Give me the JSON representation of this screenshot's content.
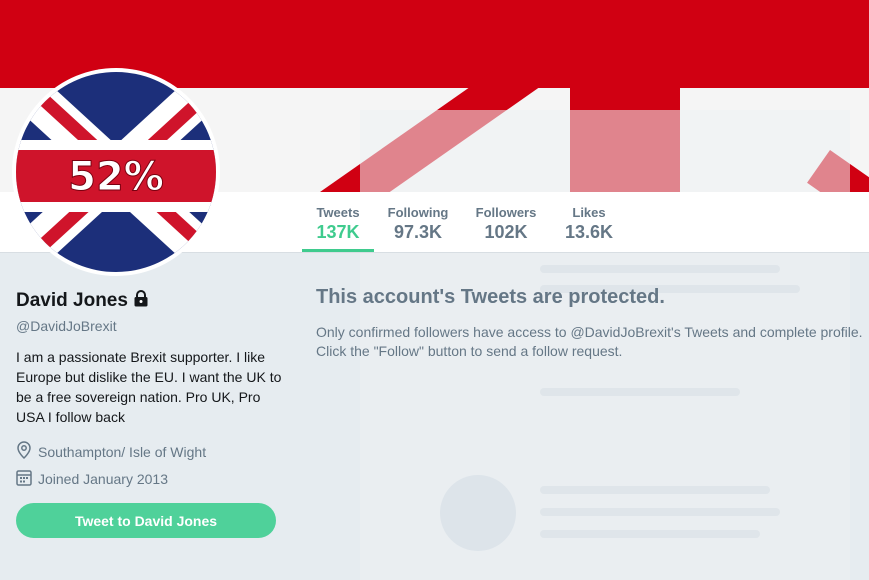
{
  "colors": {
    "accent": "#3fcb8e",
    "button": "#4fd19a",
    "banner_red": "#d00012",
    "muted": "#657786"
  },
  "avatar": {
    "badge_text": "52%"
  },
  "nav": {
    "items": [
      {
        "label": "Tweets",
        "value": "137K"
      },
      {
        "label": "Following",
        "value": "97.3K"
      },
      {
        "label": "Followers",
        "value": "102K"
      },
      {
        "label": "Likes",
        "value": "13.6K"
      }
    ]
  },
  "profile": {
    "name": "David Jones",
    "handle": "@DavidJoBrexit",
    "bio": "I am a passionate Brexit supporter. I like Europe but dislike the EU. I want the UK to be a free sovereign nation. Pro UK, Pro USA I follow back",
    "location": "Southampton/ Isle of Wight",
    "joined": "Joined January 2013",
    "tweet_button": "Tweet to David Jones",
    "location_icon": "location-pin-icon",
    "calendar_icon": "calendar-icon",
    "lock_icon": "lock-icon"
  },
  "main": {
    "protected_title": "This account's Tweets are protected.",
    "protected_text": "Only confirmed followers have access to @DavidJoBrexit's Tweets and complete profile. Click the \"Follow\" button to send a follow request."
  }
}
